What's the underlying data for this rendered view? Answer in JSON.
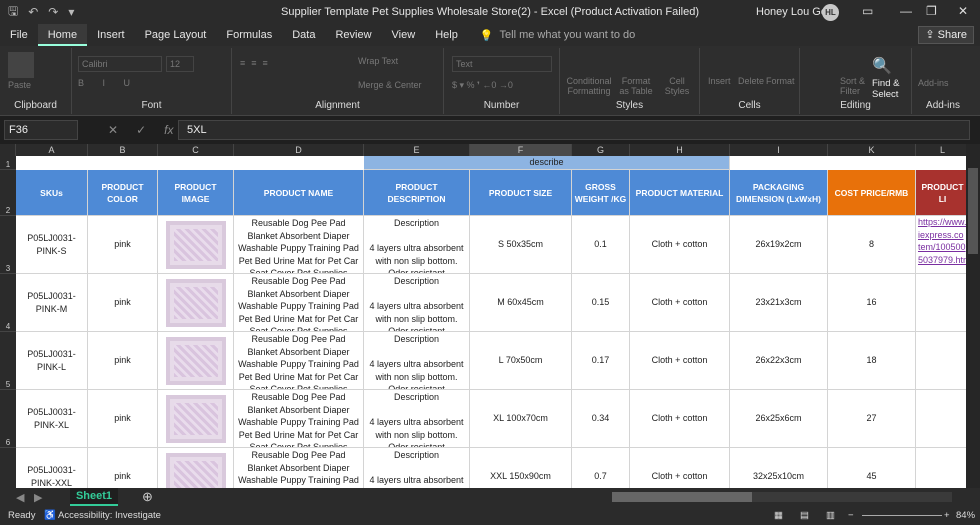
{
  "window": {
    "title": "Supplier Template Pet Supplies Wholesale Store(2)  -  Excel (Product Activation Failed)",
    "user": "Honey Lou Gony",
    "initials": "HL"
  },
  "tabs": [
    "File",
    "Home",
    "Insert",
    "Page Layout",
    "Formulas",
    "Data",
    "Review",
    "View",
    "Help"
  ],
  "tell_me": "Tell me what you want to do",
  "share": "Share",
  "ribbon": {
    "groups": [
      "Clipboard",
      "Font",
      "Alignment",
      "Number",
      "Styles",
      "Cells",
      "Editing",
      "Add-ins"
    ],
    "paste": "Paste",
    "font_name": "Calibri",
    "font_size": "12",
    "wrap": "Wrap Text",
    "merge": "Merge & Center",
    "number_format": "Text",
    "cond": "Conditional Formatting",
    "fmt_table": "Format as Table",
    "cell_styles": "Cell Styles",
    "insert": "Insert",
    "delete": "Delete",
    "format": "Format",
    "sort": "Sort & Filter",
    "find": "Find & Select",
    "addins": "Add-ins"
  },
  "formula_bar": {
    "name_box": "F36",
    "value": "5XL"
  },
  "columns": [
    "A",
    "B",
    "C",
    "D",
    "E",
    "F",
    "G",
    "H",
    "I",
    "K",
    "L"
  ],
  "rows": [
    "1",
    "2",
    "3",
    "4",
    "5",
    "6",
    "7"
  ],
  "describe": "describe",
  "headers": [
    "SKUs",
    "PRODUCT COLOR",
    "PRODUCT IMAGE",
    "PRODUCT NAME",
    "PRODUCT DESCRIPTION",
    "PRODUCT SIZE",
    "GROSS WEIGHT /KG",
    "PRODUCT MATERIAL",
    "PACKAGING DIMENSION (LxWxH)",
    "COST PRICE/RMB",
    "PRODUCT LI"
  ],
  "product_name": "Reusable Dog Pee Pad Blanket Absorbent Diaper Washable Puppy Training Pad Pet Bed Urine Mat for Pet Car Seat Cover Pet Supplies",
  "product_desc": "Description\n\n4 layers ultra absorbent with non slip bottom. Odor resistant",
  "link": "https://www. iexpress.co tem/100500 5037979.htm",
  "data_rows": [
    {
      "sku": "P05LJ0031-PINK-S",
      "color": "pink",
      "size": "S 50x35cm",
      "weight": "0.1",
      "material": "Cloth + cotton",
      "pack": "26x19x2cm",
      "price": "8"
    },
    {
      "sku": "P05LJ0031-PINK-M",
      "color": "pink",
      "size": "M 60x45cm",
      "weight": "0.15",
      "material": "Cloth + cotton",
      "pack": "23x21x3cm",
      "price": "16"
    },
    {
      "sku": "P05LJ0031-PINK-L",
      "color": "pink",
      "size": "L 70x50cm",
      "weight": "0.17",
      "material": "Cloth + cotton",
      "pack": "26x22x3cm",
      "price": "18"
    },
    {
      "sku": "P05LJ0031-PINK-XL",
      "color": "pink",
      "size": "XL 100x70cm",
      "weight": "0.34",
      "material": "Cloth + cotton",
      "pack": "26x25x6cm",
      "price": "27"
    },
    {
      "sku": "P05LJ0031-PINK-XXL",
      "color": "pink",
      "size": "XXL 150x90cm",
      "weight": "0.7",
      "material": "Cloth + cotton",
      "pack": "32x25x10cm",
      "price": "45"
    }
  ],
  "sheet": "Sheet1",
  "status": {
    "ready": "Ready",
    "accessibility": "Accessibility: Investigate",
    "zoom": "84%"
  },
  "colors": {
    "header_blue": "#4e8ad6",
    "cost_orange": "#e8710a",
    "link_red": "#a8322e",
    "describe_blue": "#8db4e2"
  }
}
